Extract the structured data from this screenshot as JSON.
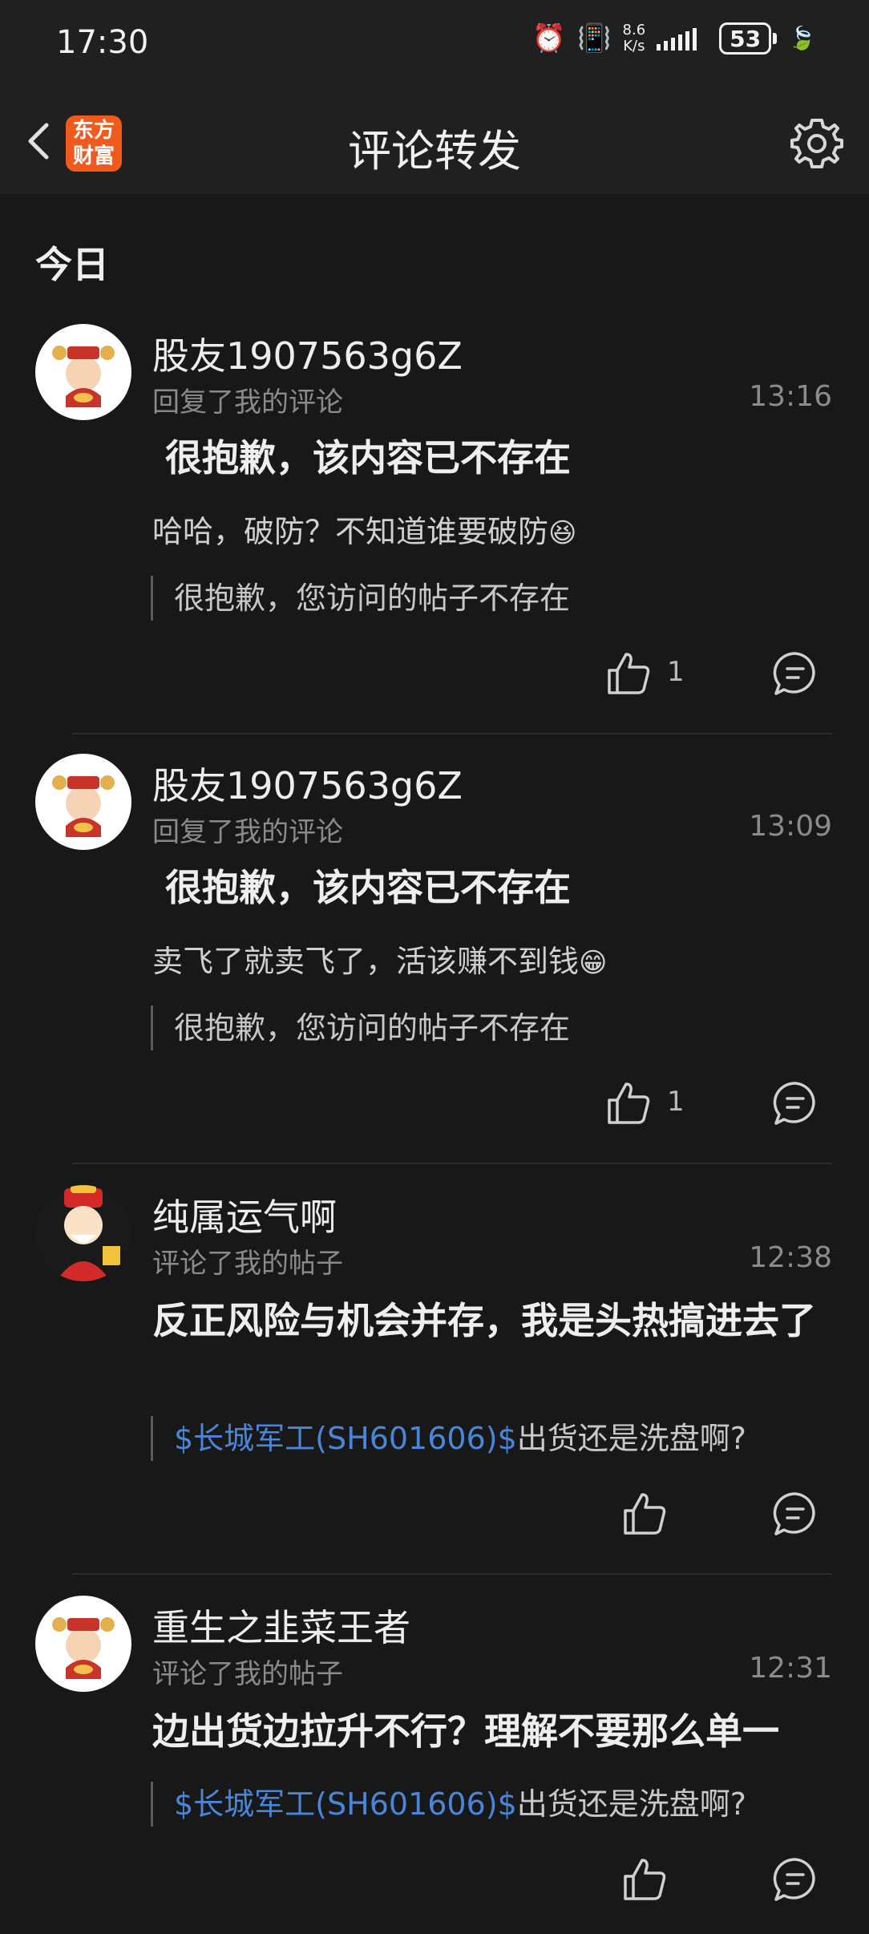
{
  "status": {
    "time": "17:30",
    "net_speed_top": "8.6",
    "net_speed_bottom": "K/s",
    "battery": "53"
  },
  "header": {
    "logo_line1": "东方",
    "logo_line2": "财富",
    "title": "评论转发"
  },
  "section_label": "今日",
  "items": [
    {
      "user": "股友1907563g6Z",
      "action": "回复了我的评论",
      "time": "13:16",
      "headline": "很抱歉，该内容已不存在",
      "comment": "哈哈，破防？不知道谁要破防",
      "emoji": "😆",
      "quote_prefix": "",
      "quote": "很抱歉，您访问的帖子不存在",
      "likes": "1"
    },
    {
      "user": "股友1907563g6Z",
      "action": "回复了我的评论",
      "time": "13:09",
      "headline": "很抱歉，该内容已不存在",
      "comment": "卖飞了就卖飞了，活该赚不到钱",
      "emoji": "😁",
      "quote_prefix": "",
      "quote": "很抱歉，您访问的帖子不存在",
      "likes": "1"
    },
    {
      "user": "纯属运气啊",
      "action": "评论了我的帖子",
      "time": "12:38",
      "headline": "反正风险与机会并存，我是头热搞进去了",
      "comment": "",
      "emoji": "",
      "quote_prefix": "$长城军工(SH601606)$",
      "quote": "出货还是洗盘啊?",
      "likes": ""
    },
    {
      "user": "重生之韭菜王者",
      "action": "评论了我的帖子",
      "time": "12:31",
      "headline": "边出货边拉升不行？理解不要那么单一",
      "comment": "",
      "emoji": "",
      "quote_prefix": "$长城军工(SH601606)$",
      "quote": "出货还是洗盘啊?",
      "likes": ""
    }
  ],
  "colors": {
    "background": "#181818",
    "bar": "#202020",
    "stock_link": "#4a86d8",
    "logo": "#f25a1d"
  }
}
